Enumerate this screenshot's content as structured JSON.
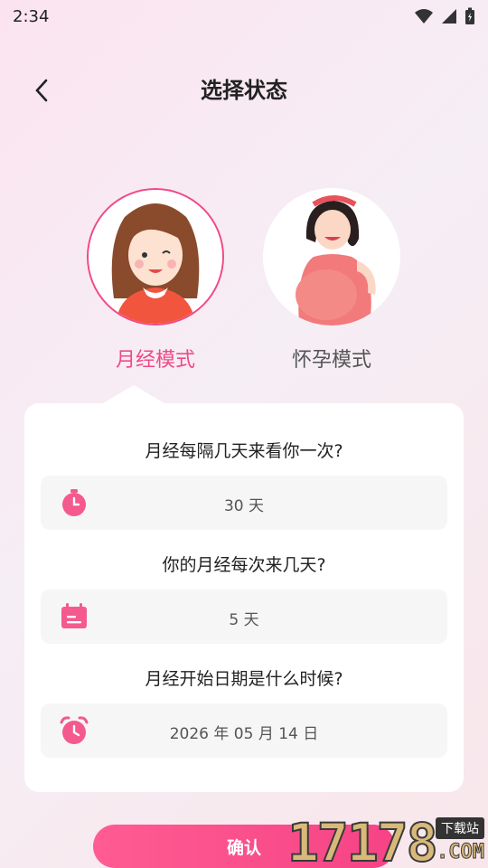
{
  "status": {
    "time": "2:34"
  },
  "header": {
    "title": "选择状态"
  },
  "modes": [
    {
      "label": "月经模式",
      "selected": true
    },
    {
      "label": "怀孕模式",
      "selected": false
    }
  ],
  "form": {
    "cycle": {
      "question": "月经每隔几天来看你一次?",
      "value": "30 天",
      "icon": "timer-icon"
    },
    "duration": {
      "question": "你的月经每次来几天?",
      "value": "5 天",
      "icon": "calendar-icon"
    },
    "start": {
      "question": "月经开始日期是什么时候?",
      "value": "2026 年 05 月 14 日",
      "icon": "alarm-clock-icon"
    }
  },
  "confirm_label": "确认",
  "watermark": {
    "digits": "17178",
    "tag": "下载站",
    "suffix": ".COM"
  },
  "colors": {
    "accent": "#f04a86",
    "button": "#f64385"
  }
}
